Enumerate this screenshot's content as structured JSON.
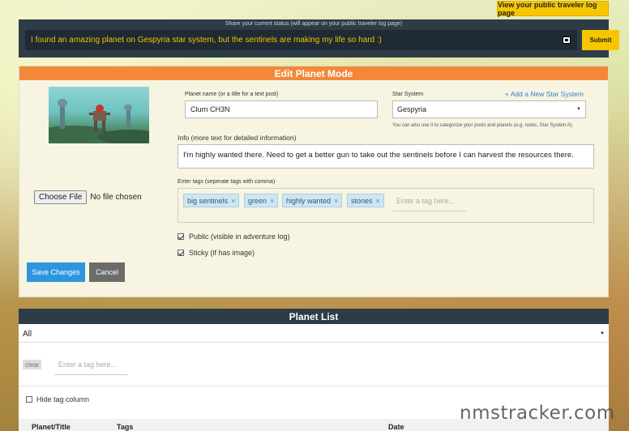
{
  "top_bar": {
    "view_log_label": "View your public traveler log page"
  },
  "status": {
    "caption": "Share your current status (will appear on your public traveler log page)",
    "text": "I found an amazing planet on Gespyria star system, but the sentinels are making my life so hard :)",
    "submit_label": "Submit",
    "emoji_icon": "emoji-picker-icon"
  },
  "edit": {
    "title": "Edit Planet Mode",
    "choose_file_label": "Choose File",
    "file_status": "No file chosen",
    "planet_name_label": "Planet name (or a title for a text post)",
    "planet_name_value": "Clurn CH3N",
    "star_system_label": "Star System",
    "add_star_system_label": "+ Add a New Star System",
    "star_system_value": "Gespyria",
    "star_system_help": "You can also use it to categorize your posts and planets (e.g. notes, Star System A).",
    "info_label": "Info (more text for detailed information)",
    "info_value": "I'm highly wanted there. Need to get a better gun to take out the sentinels before I can harvest the resources there.",
    "tags_label": "Enter tags (seperate tags with comma)",
    "tags": [
      "big sentinels",
      "green",
      "highly wanted",
      "stones"
    ],
    "tag_placeholder": "Enter a tag here...",
    "public_label": "Public (visible in adventure log)",
    "public_checked": true,
    "sticky_label": "Sticky (if has image)",
    "sticky_checked": true,
    "save_label": "Save Changes",
    "cancel_label": "Cancel"
  },
  "list": {
    "title": "Planet List",
    "filter_value": "All",
    "clear_label": "clear",
    "tag_placeholder": "Enter a tag here...",
    "hide_tag_label": "Hide tag column",
    "columns": [
      "Planet/Title",
      "Tags",
      "Date"
    ]
  },
  "watermark": "nmstracker.com",
  "colors": {
    "accent_yellow": "#f7c600",
    "header_orange": "#f4883a",
    "dark_panel": "#2e3c48",
    "save_blue": "#2c97dc",
    "cancel_gray": "#6b6b6b",
    "tag_blue": "#cfe6f2"
  }
}
